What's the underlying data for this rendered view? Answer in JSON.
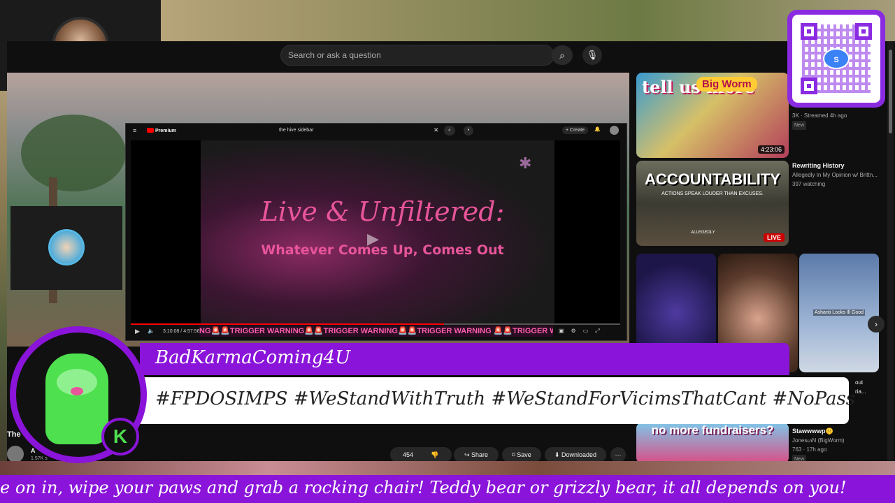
{
  "search": {
    "placeholder": "Search or ask a question"
  },
  "inner_player": {
    "brand": "Premium",
    "search_text": "the hive sidebar",
    "create_label": "Create",
    "title_line1": "Live & Unfiltered:",
    "title_line2": "Whatever Comes Up, Comes Out",
    "time": "3:10:08 / 4:57:56",
    "ticker": "NG🚨🚨TRIGGER WARNING🚨🚨TRIGGER WARNING🚨🚨TRIGGER WARNING 🚨🚨TRIGGER W"
  },
  "sidebar": {
    "video1": {
      "thumb_text_1": "tell us more",
      "thumb_text_2": "Big Worm",
      "duration": "4:23:06",
      "views": "3K",
      "age": "Streamed 4h ago",
      "badge": "New"
    },
    "video2": {
      "title": "Rewriting History",
      "channel": "Allegedly In My Opinion w/ Brittn...",
      "watching": "397 watching",
      "thumb_big": "ACCOUNTABILITY",
      "thumb_small": "ACTIONS SPEAK LOUDER THAN EXCUSES.",
      "thumb_brand": "ALLEGEDLY",
      "live": "LIVE"
    },
    "short3_caption": "Ashanti Looks Ill Good",
    "video3": {
      "thumb_text": "no more fundraisers?",
      "title": "Stawwwwp🤫",
      "channel": "JonesᔕN (BigWorm)",
      "views": "763",
      "age": "17h ago",
      "badge": "New"
    },
    "partial1": "out",
    "partial2": "ria..."
  },
  "video_meta": {
    "title_partial": "The",
    "channel_partial": "A",
    "subs_partial": "1.57K s",
    "likes": "454",
    "share": "Share",
    "save": "Save",
    "download": "Downloaded"
  },
  "overlay": {
    "name": "BadKarmaComing4U",
    "hashtags": "#FPDOSIMPS #WeStandWithTruth #WeStandForVicimsThatCant #NoPass",
    "ticker": "e on in, wipe your paws and grab a rocking chair! Teddy bear or grizzly bear, it all depends on you!",
    "k_badge": "K"
  },
  "qr": {
    "logo_text": "S"
  },
  "colors": {
    "accent_purple": "#8a14d9",
    "live_red": "#cc0000",
    "title_pink": "#e8559a"
  }
}
